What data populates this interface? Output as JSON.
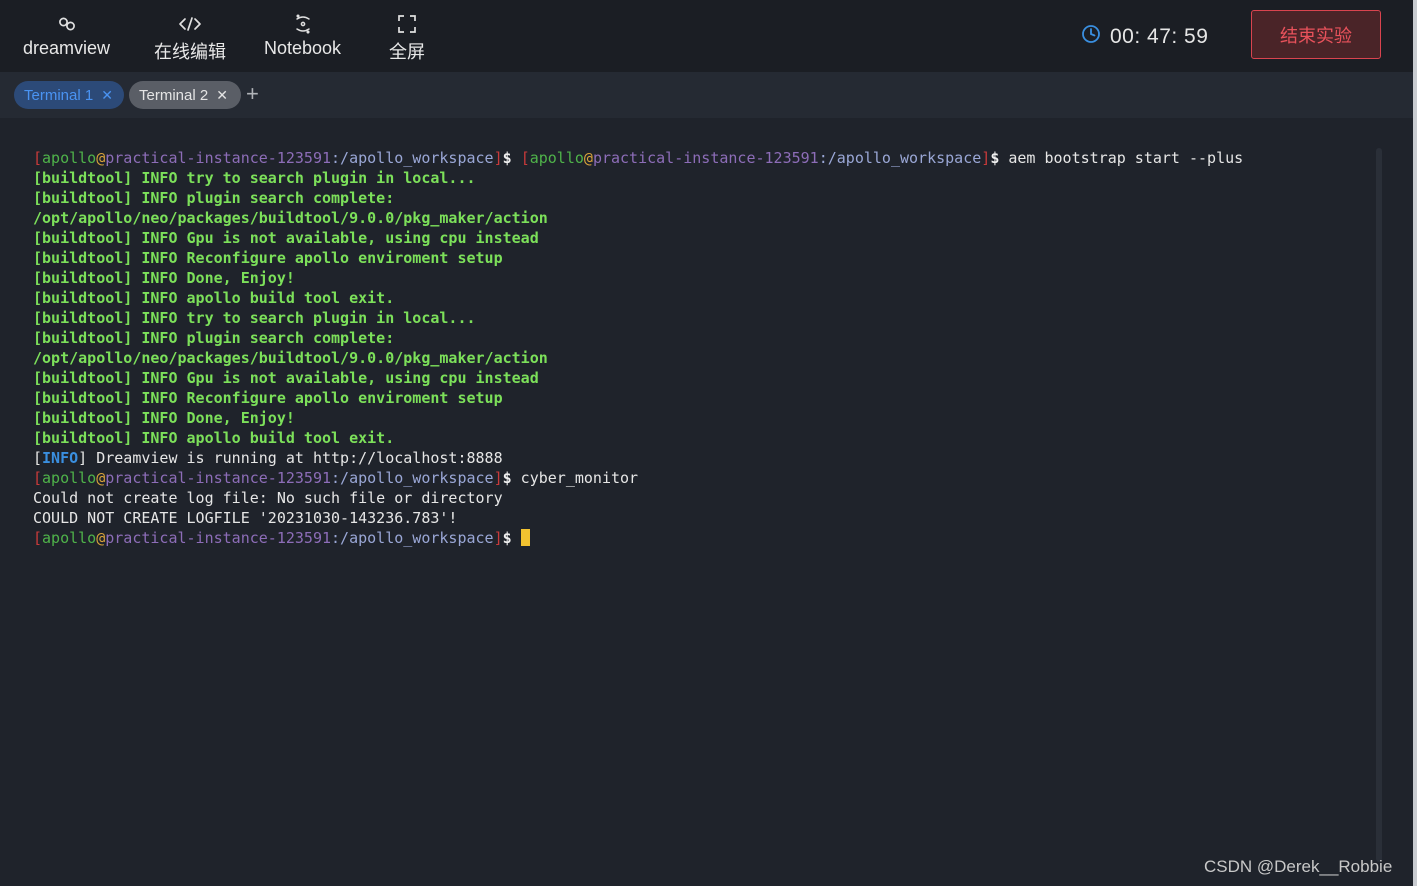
{
  "toolbar": {
    "items": [
      {
        "label": "dreamview",
        "icon": "link-icon"
      },
      {
        "label": "在线编辑",
        "icon": "code-icon"
      },
      {
        "label": "Notebook",
        "icon": "notebook-icon"
      },
      {
        "label": "全屏",
        "icon": "fullscreen-icon"
      }
    ],
    "timer": "00: 47: 59",
    "end_button": "结束实验"
  },
  "tabs": [
    {
      "label": "Terminal 1",
      "active": true
    },
    {
      "label": "Terminal 2",
      "active": false
    }
  ],
  "add_tab": "+",
  "terminal": {
    "prompt": {
      "user": "apollo",
      "at": "@",
      "host": "practical-instance-123591",
      "path": ":/apollo_workspace",
      "open": "[",
      "close": "]",
      "dollar": "$"
    },
    "line0_command": " aem bootstrap start --plus",
    "build_lines": [
      "[buildtool] INFO try to search plugin in local...",
      "[buildtool] INFO plugin search complete:",
      "/opt/apollo/neo/packages/buildtool/9.0.0/pkg_maker/action",
      "[buildtool] INFO Gpu is not available, using cpu instead",
      "[buildtool] INFO Reconfigure apollo enviroment setup",
      "[buildtool] INFO Done, Enjoy!",
      "[buildtool] INFO apollo build tool exit.",
      "[buildtool] INFO try to search plugin in local...",
      "[buildtool] INFO plugin search complete:",
      "/opt/apollo/neo/packages/buildtool/9.0.0/pkg_maker/action",
      "[buildtool] INFO Gpu is not available, using cpu instead",
      "[buildtool] INFO Reconfigure apollo enviroment setup",
      "[buildtool] INFO Done, Enjoy!",
      "[buildtool] INFO apollo build tool exit."
    ],
    "info_line": {
      "open": "[",
      "tag": "INFO",
      "rest": "] Dreamview is running at http://localhost:8888"
    },
    "line_cyber_command": " cyber_monitor",
    "error_lines": [
      "Could not create log file: No such file or directory",
      "COULD NOT CREATE LOGFILE '20231030-143236.783'!"
    ]
  },
  "watermark": "CSDN @Derek__Robbie",
  "colors": {
    "end_button": "#e8525b",
    "active_tab": "#4a93f2",
    "green_output": "#7ce05a",
    "cursor": "#f2c230"
  }
}
